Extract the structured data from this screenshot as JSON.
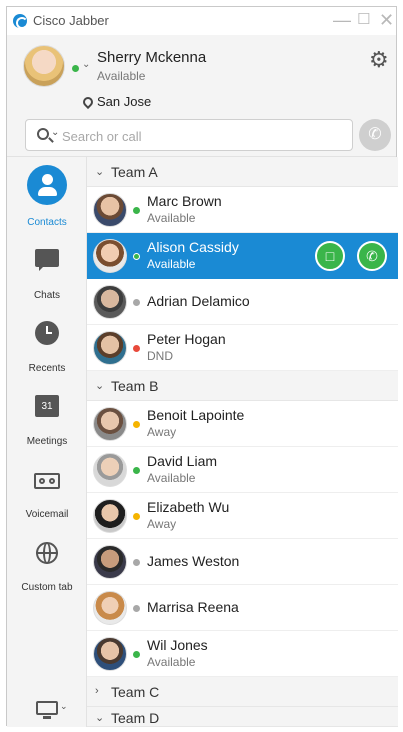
{
  "window": {
    "title": "Cisco Jabber"
  },
  "profile": {
    "name": "Sherry Mckenna",
    "presence": "Available",
    "location": "San Jose",
    "status_color": "#3ab54a"
  },
  "search": {
    "placeholder": "Search or call"
  },
  "sidebar": {
    "items": [
      {
        "label": "Contacts",
        "icon": "contacts-icon",
        "active": true
      },
      {
        "label": "Chats",
        "icon": "chat-icon"
      },
      {
        "label": "Recents",
        "icon": "clock-icon"
      },
      {
        "label": "Meetings",
        "icon": "calendar-icon",
        "icon_text": "31"
      },
      {
        "label": "Voicemail",
        "icon": "voicemail-icon"
      },
      {
        "label": "Custom tab",
        "icon": "globe-icon"
      }
    ]
  },
  "colors": {
    "accent": "#1a8ad4",
    "available": "#3ab54a",
    "away": "#f5b400",
    "dnd": "#e84a3b",
    "offline": "#a8a8a8"
  },
  "groups": [
    {
      "name": "Team A",
      "expanded": true,
      "contacts": [
        {
          "name": "Marc Brown",
          "status": "Available",
          "presence": "available"
        },
        {
          "name": "Alison Cassidy",
          "status": "Available",
          "presence": "available",
          "selected": true
        },
        {
          "name": "Adrian Delamico",
          "status": "",
          "presence": "offline"
        },
        {
          "name": "Peter Hogan",
          "status": "DND",
          "presence": "dnd"
        }
      ]
    },
    {
      "name": "Team B",
      "expanded": true,
      "contacts": [
        {
          "name": "Benoit Lapointe",
          "status": "Away",
          "presence": "away"
        },
        {
          "name": "David Liam",
          "status": "Available",
          "presence": "available"
        },
        {
          "name": "Elizabeth Wu",
          "status": "Away",
          "presence": "away"
        },
        {
          "name": "James Weston",
          "status": "",
          "presence": "offline"
        },
        {
          "name": "Marrisa Reena",
          "status": "",
          "presence": "offline"
        },
        {
          "name": "Wil Jones",
          "status": "Available",
          "presence": "available"
        }
      ]
    },
    {
      "name": "Team C",
      "expanded": false
    },
    {
      "name": "Team D",
      "expanded": true
    }
  ]
}
